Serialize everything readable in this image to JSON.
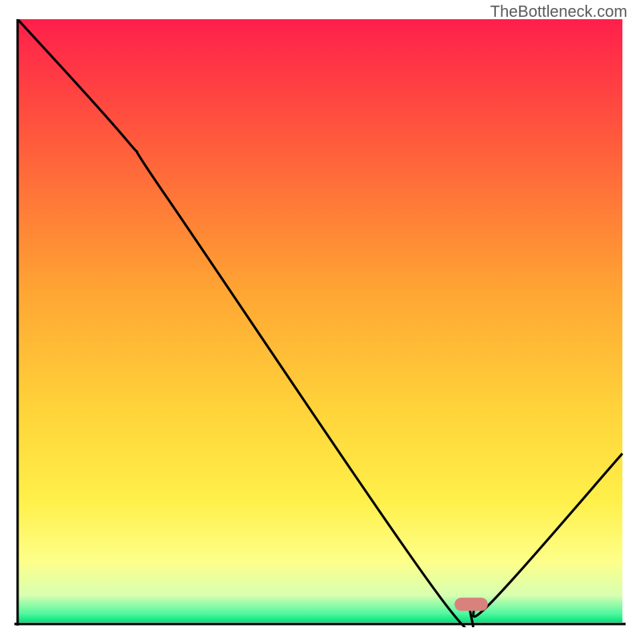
{
  "watermark": "TheBottleneck.com",
  "chart_data": {
    "type": "line",
    "title": "",
    "xlabel": "",
    "ylabel": "",
    "xlim": [
      0,
      100
    ],
    "ylim": [
      0,
      100
    ],
    "series": [
      {
        "name": "curve",
        "x": [
          0,
          18,
          25,
          70,
          75,
          78,
          100
        ],
        "values": [
          100,
          80,
          70,
          4,
          3,
          3,
          28
        ]
      }
    ],
    "marker": {
      "x": 75,
      "y": 3,
      "width": 5.5,
      "height": 2.2,
      "color": "#d9817c"
    },
    "gradient_stops": [
      {
        "offset": 0.0,
        "color": "#ff1f4b"
      },
      {
        "offset": 0.2,
        "color": "#ff5a3c"
      },
      {
        "offset": 0.45,
        "color": "#ffa533"
      },
      {
        "offset": 0.65,
        "color": "#ffd43a"
      },
      {
        "offset": 0.8,
        "color": "#fff04a"
      },
      {
        "offset": 0.9,
        "color": "#fdff8a"
      },
      {
        "offset": 0.955,
        "color": "#d8ffb0"
      },
      {
        "offset": 0.985,
        "color": "#54f7a0"
      },
      {
        "offset": 1.0,
        "color": "#00e37a"
      }
    ],
    "axes": {
      "color": "#000000",
      "width": 3
    }
  }
}
